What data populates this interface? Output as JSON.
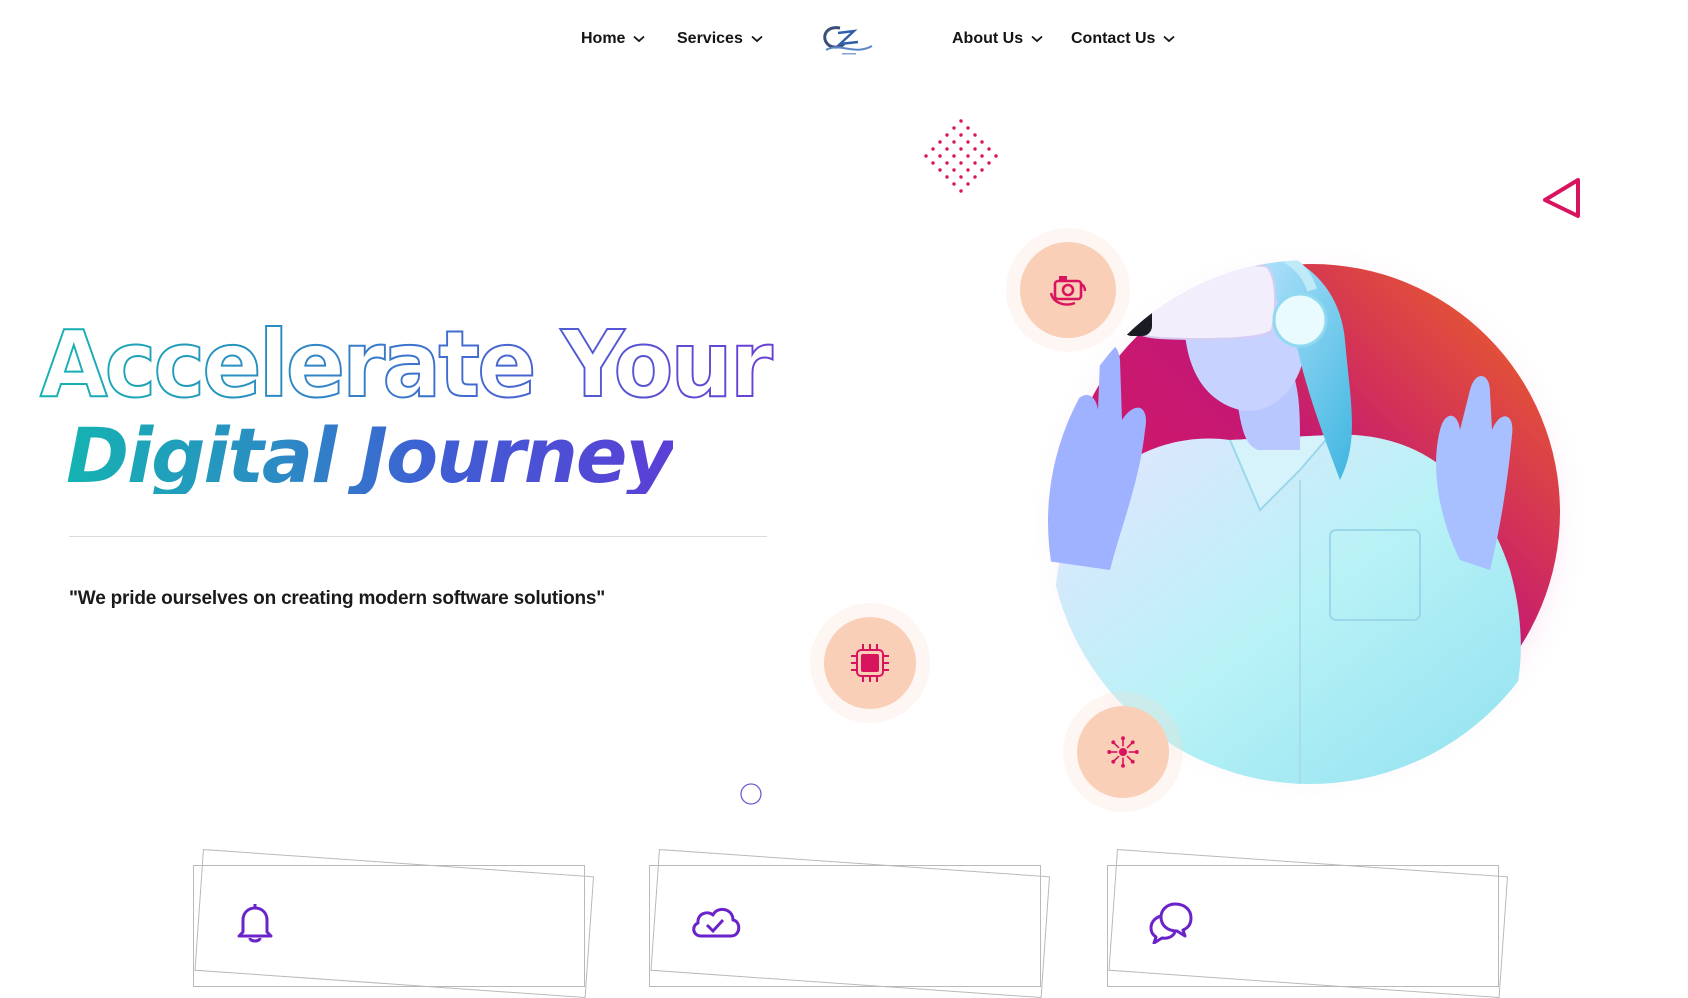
{
  "nav": {
    "items_left": [
      {
        "label": "Home"
      },
      {
        "label": "Services"
      }
    ],
    "items_right": [
      {
        "label": "About Us"
      },
      {
        "label": "Contact Us"
      }
    ],
    "logo_icon": "cz-logo"
  },
  "hero": {
    "headline_outline": "Accelerate Your",
    "headline_solid": "Digital Journey",
    "tagline": "\"We pride ourselves on creating modern software solutions\""
  },
  "icons": {
    "bubble_1": "camera-rotate-icon",
    "bubble_2": "chip-icon",
    "bubble_3": "network-icon",
    "card_1": "bell-icon",
    "card_2": "cloud-check-icon",
    "card_3": "chat-bubbles-icon"
  },
  "colors": {
    "accent_teal": "#14b3b1",
    "accent_purple": "#5b3fd6",
    "accent_pink": "#d9145f",
    "bubble_bg": "#f9cfb8",
    "icon_purple": "#6a23c9"
  }
}
